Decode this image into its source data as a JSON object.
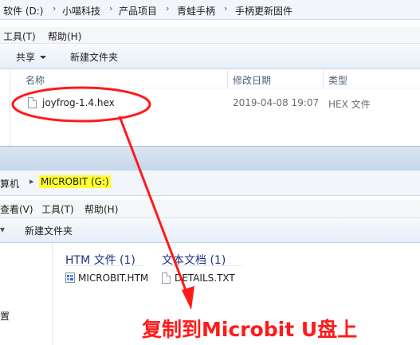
{
  "top_window": {
    "breadcrumb": [
      "软件 (D:)",
      "小喵科技",
      "产品项目",
      "青蛙手柄",
      "手柄更新固件"
    ],
    "menu": [
      "工具(T)",
      "帮助(H)"
    ],
    "toolbar": {
      "share": "共享",
      "new_folder": "新建文件夹"
    },
    "columns": [
      "名称",
      "修改日期",
      "类型"
    ],
    "files": [
      {
        "name": "joyfrog-1.4.hex",
        "modified": "2019-04-08 19:07",
        "type": "HEX 文件"
      }
    ]
  },
  "bottom_window": {
    "breadcrumb": [
      "算机",
      "MICROBIT (G:)"
    ],
    "menu": [
      "查看(V)",
      "工具(T)",
      "帮助(H)"
    ],
    "toolbar": {
      "new_folder": "新建文件夹"
    },
    "groups": [
      {
        "label": "HTM 文件 (1)",
        "files": [
          {
            "name": "MICROBIT.HTM"
          }
        ]
      },
      {
        "label": "文本文档 (1)",
        "files": [
          {
            "name": "DETAILS.TXT"
          }
        ]
      }
    ],
    "sidebar_partial": "置"
  },
  "annotation": {
    "text": "复制到Microbit U盘上",
    "color": "#ff1a1a"
  }
}
